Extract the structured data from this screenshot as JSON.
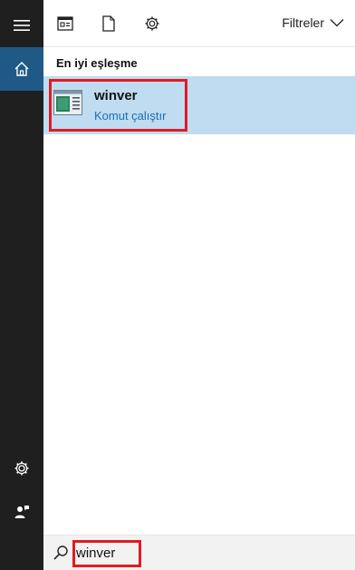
{
  "sidebar": {
    "icons": [
      "hamburger-menu-icon",
      "home-icon",
      "settings-gear-icon",
      "feedback-person-icon"
    ]
  },
  "toolbar": {
    "icons": [
      "apps-icon",
      "documents-icon",
      "settings-icon"
    ],
    "filters_label": "Filtreler"
  },
  "results": {
    "section_title": "En iyi eşleşme",
    "best_match": {
      "title": "winver",
      "subtitle": "Komut çalıştır"
    }
  },
  "search": {
    "value": "winver"
  },
  "colors": {
    "rail": "#1f1f1f",
    "rail_active": "#1f5a86",
    "selection": "#bfdcf0",
    "link": "#1a6fb5",
    "highlight": "#e01b24"
  }
}
